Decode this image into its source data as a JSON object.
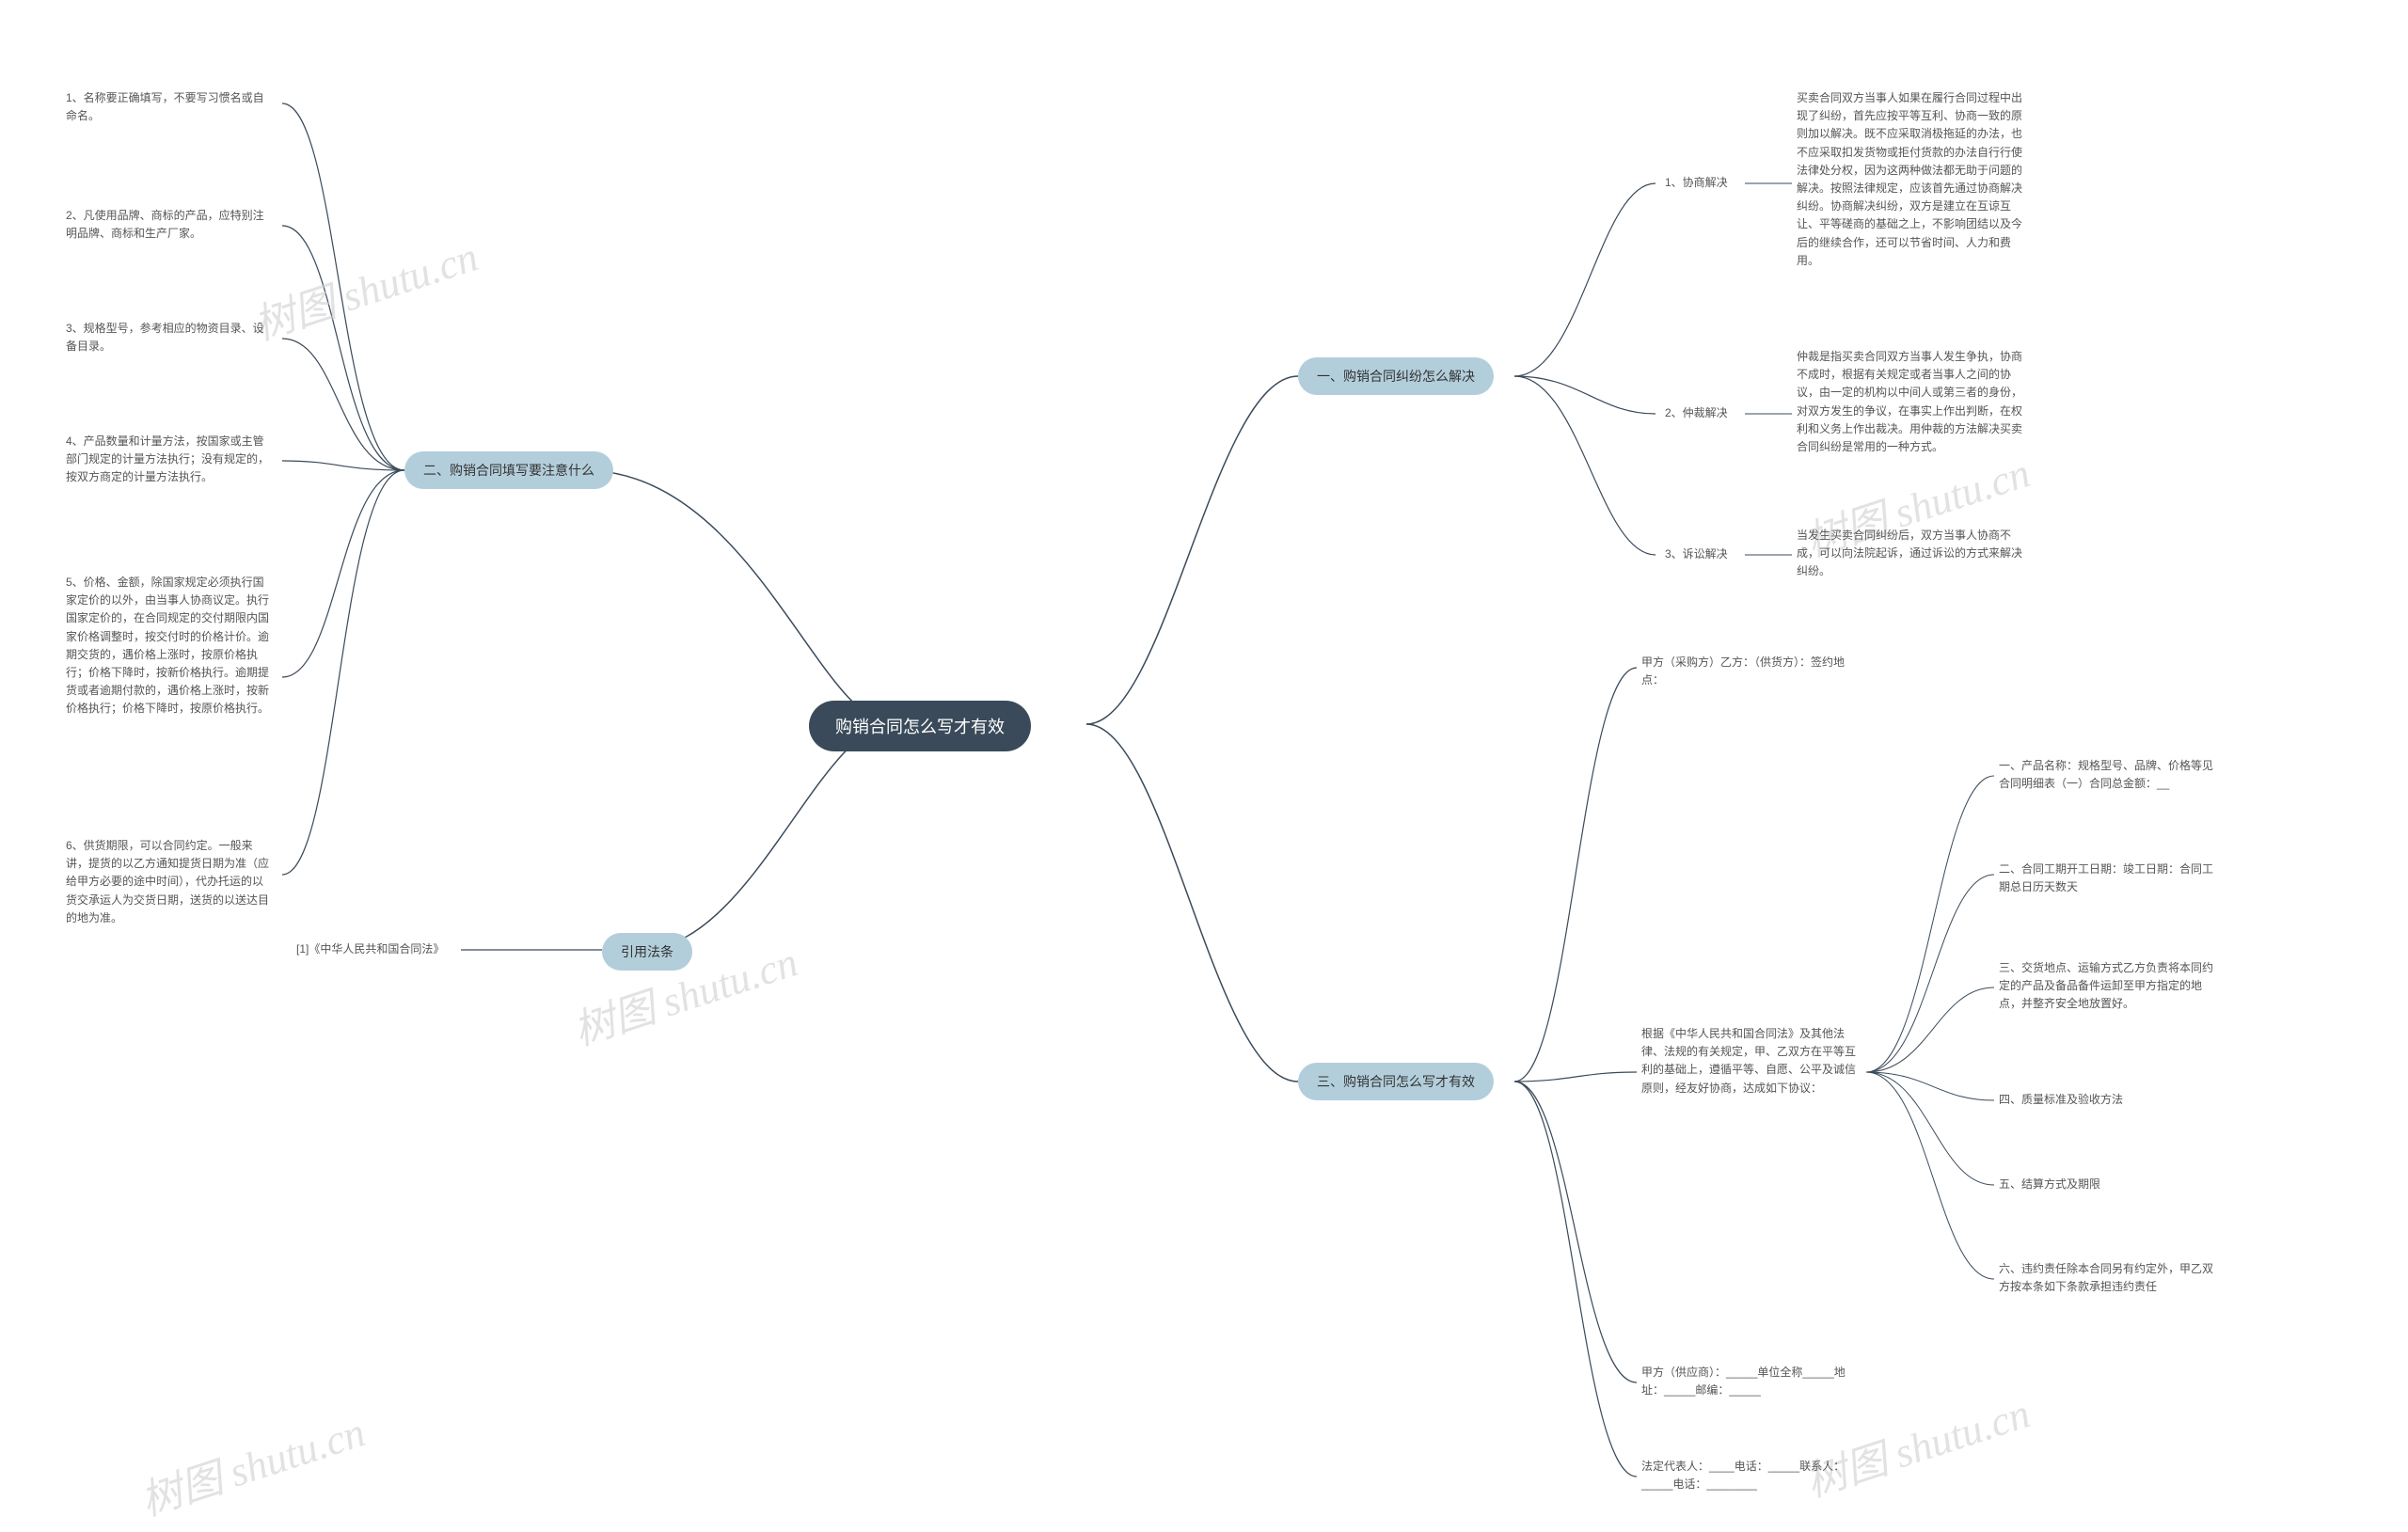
{
  "watermark": "树图 shutu.cn",
  "center": {
    "title": "购销合同怎么写才有效"
  },
  "right": {
    "n1": {
      "title": "一、购销合同纠纷怎么解决",
      "items": {
        "a": {
          "label": "1、协商解决",
          "desc": "买卖合同双方当事人如果在履行合同过程中出现了纠纷，首先应按平等互利、协商一致的原则加以解决。既不应采取消极拖延的办法，也不应采取扣发货物或拒付货款的办法自行行使法律处分权，因为这两种做法都无助于问题的解决。按照法律规定，应该首先通过协商解决纠纷。协商解决纠纷，双方是建立在互谅互让、平等磋商的基础之上，不影响团结以及今后的继续合作，还可以节省时间、人力和费用。"
        },
        "b": {
          "label": "2、仲裁解决",
          "desc": "仲裁是指买卖合同双方当事人发生争执，协商不成时，根据有关规定或者当事人之间的协议，由一定的机构以中间人或第三者的身份，对双方发生的争议，在事实上作出判断，在权利和义务上作出裁决。用仲裁的方法解决买卖合同纠纷是常用的一种方式。"
        },
        "c": {
          "label": "3、诉讼解决",
          "desc": "当发生买卖合同纠纷后，双方当事人协商不成，可以向法院起诉，通过诉讼的方式来解决纠纷。"
        }
      }
    },
    "n3": {
      "title": "三、购销合同怎么写才有效",
      "items": {
        "a": "甲方（采购方）乙方：（供货方）：签约地点：",
        "b": {
          "intro": "根据《中华人民共和国合同法》及其他法律、法规的有关规定，甲、乙双方在平等互利的基础上，遵循平等、自愿、公平及诚信原则，经友好协商，达成如下协议：",
          "c1": "一、产品名称：规格型号、品牌、价格等见合同明细表（一）合同总金额：__",
          "c2": "二、合同工期开工日期：竣工日期：合同工期总日历天数天",
          "c3": "三、交货地点、运输方式乙方负责将本同约定的产品及备品备件运卸至甲方指定的地点，并整齐安全地放置好。",
          "c4": "四、质量标准及验收方法",
          "c5": "五、结算方式及期限",
          "c6": "六、违约责任除本合同另有约定外，甲乙双方按本条如下条款承担违约责任"
        },
        "c": "甲方（供应商）：_____单位全称_____地址：_____邮编：_____",
        "d": "法定代表人：____电话：_____联系人：_____电话：________"
      }
    }
  },
  "left": {
    "n2": {
      "title": "二、购销合同填写要注意什么",
      "items": {
        "a": "1、名称要正确填写，不要写习惯名或自命名。",
        "b": "2、凡使用品牌、商标的产品，应特别注明品牌、商标和生产厂家。",
        "c": "3、规格型号，参考相应的物资目录、设备目录。",
        "d": "4、产品数量和计量方法，按国家或主管部门规定的计量方法执行；没有规定的，按双方商定的计量方法执行。",
        "e": "5、价格、金额，除国家规定必须执行国家定价的以外，由当事人协商议定。执行国家定价的，在合同规定的交付期限内国家价格调整时，按交付时的价格计价。逾期交货的，遇价格上涨时，按原价格执行；价格下降时，按新价格执行。逾期提货或者逾期付款的，遇价格上涨时，按新价格执行；价格下降时，按原价格执行。",
        "f": "6、供货期限，可以合同约定。一般来讲，提货的以乙方通知提货日期为准（应给甲方必要的途中时间），代办托运的以货交承运人为交货日期，送货的以送达目的地为准。"
      }
    },
    "ref": {
      "title": "引用法条",
      "items": {
        "a": "[1]《中华人民共和国合同法》"
      }
    }
  }
}
